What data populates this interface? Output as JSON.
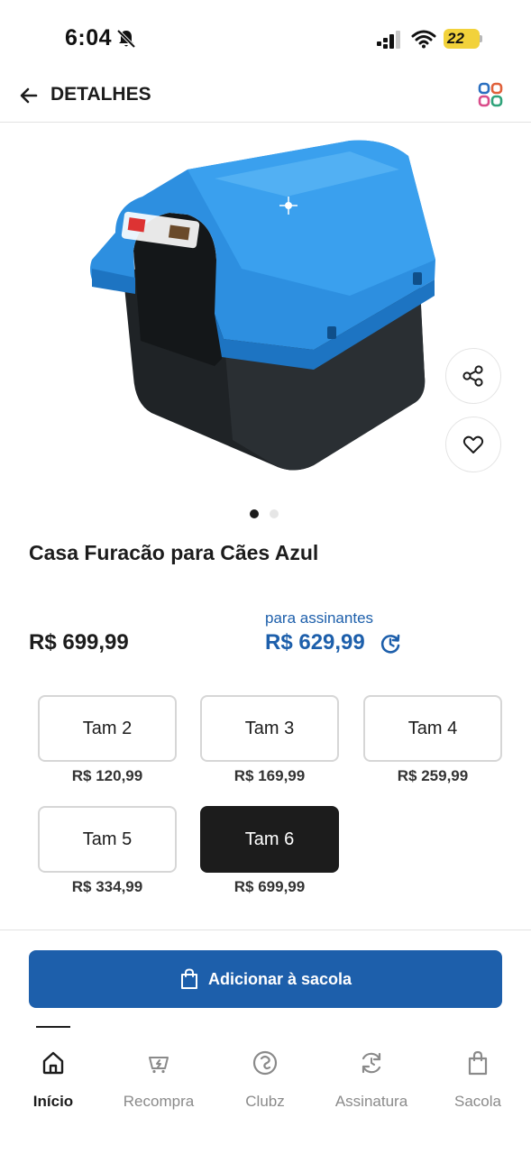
{
  "status_bar": {
    "time": "6:04",
    "battery": "22"
  },
  "header": {
    "title": "DETALHES"
  },
  "product": {
    "title": "Casa Furacão para Cães Azul",
    "price": "R$ 699,99",
    "subscriber_label": "para assinantes",
    "subscriber_price": "R$ 629,99",
    "image_count": 2,
    "active_image": 1
  },
  "sizes": [
    {
      "label": "Tam 2",
      "price": "R$ 120,99",
      "selected": false
    },
    {
      "label": "Tam 3",
      "price": "R$ 169,99",
      "selected": false
    },
    {
      "label": "Tam 4",
      "price": "R$ 259,99",
      "selected": false
    },
    {
      "label": "Tam 5",
      "price": "R$ 334,99",
      "selected": false
    },
    {
      "label": "Tam 6",
      "price": "R$ 699,99",
      "selected": true
    }
  ],
  "actions": {
    "add_to_bag": "Adicionar à sacola"
  },
  "bottom_nav": [
    {
      "label": "Início",
      "icon": "home-icon",
      "active": true
    },
    {
      "label": "Recompra",
      "icon": "repurchase-icon",
      "active": false
    },
    {
      "label": "Clubz",
      "icon": "clubz-icon",
      "active": false
    },
    {
      "label": "Assinatura",
      "icon": "subscription-icon",
      "active": false
    },
    {
      "label": "Sacola",
      "icon": "bag-icon",
      "active": false
    }
  ],
  "colors": {
    "accent": "#1d5fab",
    "selected_option": "#1c1c1c",
    "product_blue": "#2d8fe0",
    "product_dark": "#1f2326",
    "battery": "#f2d23b"
  }
}
